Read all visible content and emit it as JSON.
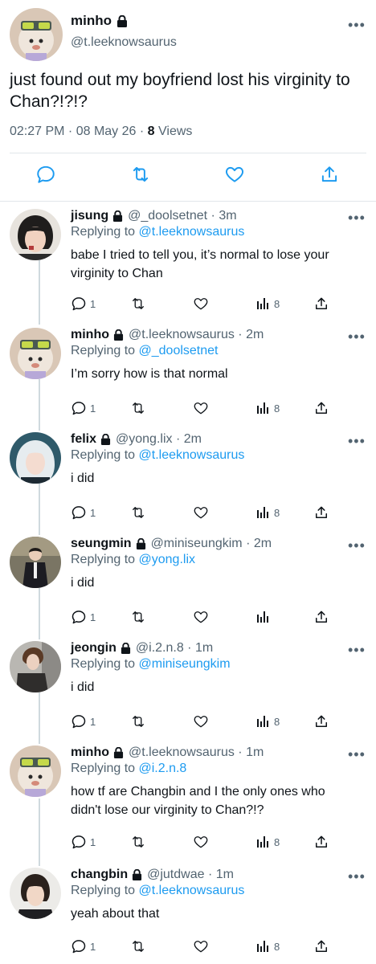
{
  "main": {
    "name": "minho",
    "handle": "@t.leeknowsaurus",
    "text": "just found out my boyfriend lost his virginity to Chan?!?!?",
    "timestamp": "02:27 PM · 08 May 26 · ",
    "views_count": "8",
    "views_label": "Views"
  },
  "replies": [
    {
      "name": "jisung",
      "handle": "@_doolsetnet",
      "time": "3m",
      "reply_prefix": "Replying to",
      "reply_to": "@t.leeknowsaurus",
      "text": "babe I tried to tell you, it’s normal to lose your virginity to Chan",
      "replies": "1",
      "views": "8"
    },
    {
      "name": "minho",
      "handle": "@t.leeknowsaurus",
      "time": "2m",
      "reply_prefix": "Replying to",
      "reply_to": "@_doolsetnet",
      "text": "I’m sorry how is that normal",
      "replies": "1",
      "views": "8"
    },
    {
      "name": "felix",
      "handle": "@yong.lix",
      "time": "2m",
      "reply_prefix": "Replying to",
      "reply_to": "@t.leeknowsaurus",
      "text": "i did",
      "replies": "1",
      "views": "8"
    },
    {
      "name": "seungmin",
      "handle": "@miniseungkim",
      "time": "2m",
      "reply_prefix": "Replying to",
      "reply_to": "@yong.lix",
      "text": "i did",
      "replies": "1",
      "views": ""
    },
    {
      "name": "jeongin",
      "handle": "@i.2.n.8",
      "time": "1m",
      "reply_prefix": "Replying to",
      "reply_to": "@miniseungkim",
      "text": "i did",
      "replies": "1",
      "views": "8"
    },
    {
      "name": "minho",
      "handle": "@t.leeknowsaurus",
      "time": "1m",
      "reply_prefix": "Replying to",
      "reply_to": "@i.2.n.8",
      "text": "how tf are Changbin and I the only ones who didn't lose our virginity to Chan?!?",
      "replies": "1",
      "views": "8"
    },
    {
      "name": "changbin",
      "handle": "@jutdwae",
      "time": "1m",
      "reply_prefix": "Replying to",
      "reply_to": "@t.leeknowsaurus",
      "text": "yeah about that",
      "replies": "1",
      "views": "8"
    }
  ],
  "icons": {
    "more": "more-icon",
    "lock": "lock-icon",
    "reply": "reply-icon",
    "retweet": "retweet-icon",
    "like": "like-icon",
    "views": "views-icon",
    "share": "share-icon"
  },
  "colors": {
    "text": "#0f1419",
    "secondary": "#536471",
    "link": "#1d9bf0",
    "divider": "#e1e6ea",
    "thread_line": "#cfd9de"
  }
}
